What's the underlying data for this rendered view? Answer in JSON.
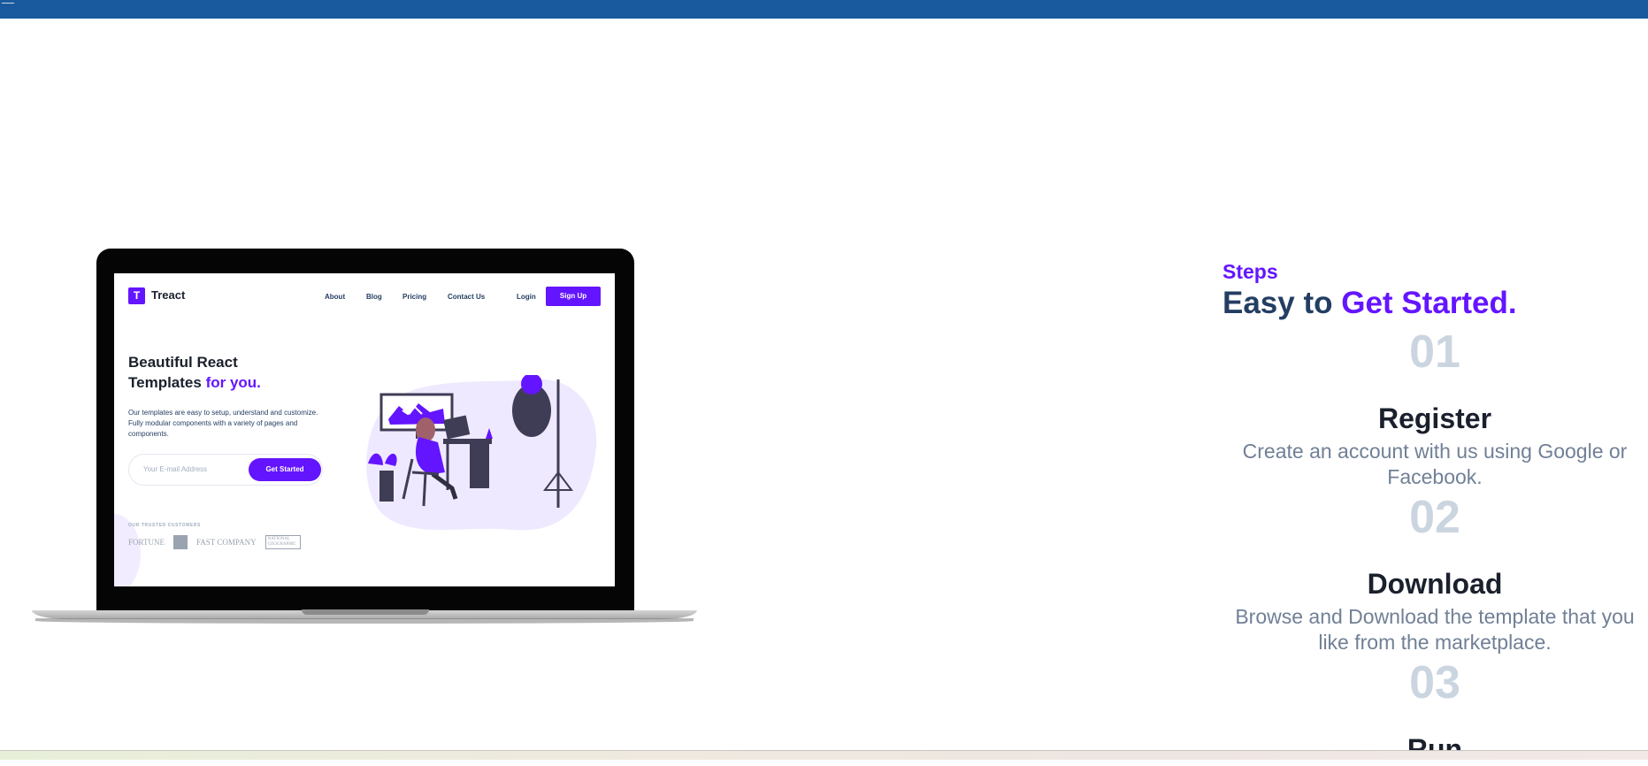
{
  "mockup": {
    "brand_letter": "T",
    "brand": "Treact",
    "nav": [
      "About",
      "Blog",
      "Pricing",
      "Contact Us"
    ],
    "login": "Login",
    "signup": "Sign Up",
    "heading_line1": "Beautiful React",
    "heading_line2": "Templates ",
    "heading_accent": "for you.",
    "description": "Our templates are easy to setup, understand and customize. Fully modular components with a variety of pages and components.",
    "email_placeholder": "Your E-mail Address",
    "cta": "Get Started",
    "trusted_label": "OUR TRUSTED CUSTOMERS",
    "clients": [
      "FORTUNE",
      "FAST COMPANY",
      "NATIONAL GEOGRAPHIC"
    ]
  },
  "steps": {
    "subheading": "Steps",
    "title_prefix": "Easy to ",
    "title_accent": "Get Started.",
    "items": [
      {
        "number": "01",
        "heading": "Register",
        "description": "Create an account with us using Google or Facebook."
      },
      {
        "number": "02",
        "heading": "Download",
        "description": "Browse and Download the template that you like from the marketplace."
      },
      {
        "number": "03",
        "heading": "Run",
        "description": ""
      }
    ]
  },
  "colors": {
    "primary": "#6415ff",
    "heading": "#243e63",
    "number": "#cbd5e0",
    "topbar": "#185a9d"
  }
}
